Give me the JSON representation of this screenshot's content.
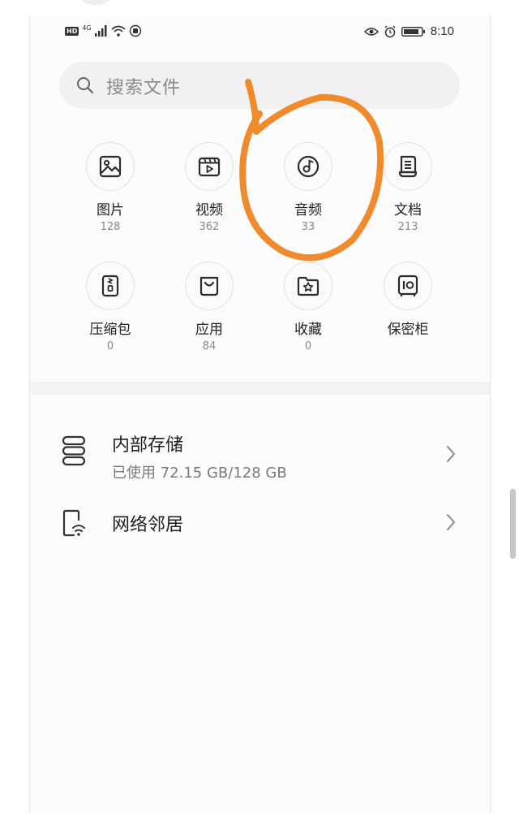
{
  "status_bar": {
    "hd": "HD",
    "network": "4G",
    "time": "8:10",
    "icons": [
      "hd-icon",
      "signal-icon",
      "wifi-icon",
      "notification-icon",
      "eye-icon",
      "alarm-icon",
      "battery-icon"
    ]
  },
  "search": {
    "placeholder": "搜索文件"
  },
  "categories": [
    {
      "label": "图片",
      "count": "128",
      "icon": "image-icon"
    },
    {
      "label": "视频",
      "count": "362",
      "icon": "video-icon"
    },
    {
      "label": "音频",
      "count": "33",
      "icon": "music-icon"
    },
    {
      "label": "文档",
      "count": "213",
      "icon": "document-icon"
    },
    {
      "label": "压缩包",
      "count": "0",
      "icon": "archive-icon"
    },
    {
      "label": "应用",
      "count": "84",
      "icon": "app-bag-icon"
    },
    {
      "label": "收藏",
      "count": "0",
      "icon": "favorites-icon"
    },
    {
      "label": "保密柜",
      "count": "",
      "icon": "safe-icon"
    }
  ],
  "storage": {
    "internal_title": "内部存储",
    "internal_usage": "已使用 72.15 GB/128 GB",
    "network_title": "网络邻居"
  },
  "colors": {
    "annotation": "#f08a2c",
    "icon_stroke": "#2b2b2b",
    "search_bg": "#f1f0f2"
  }
}
